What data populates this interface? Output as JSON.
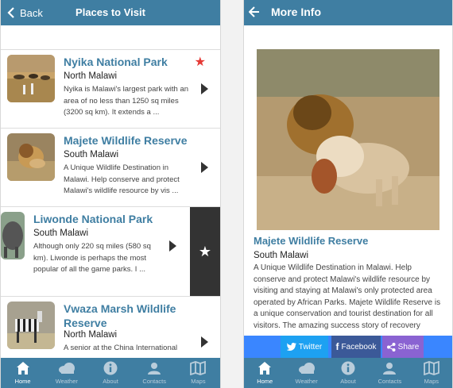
{
  "left_screen": {
    "back_label": "Back",
    "title": "Places to Visit",
    "places": [
      {
        "name": "Nyika National Park",
        "region": "North Malawi",
        "description": "Nyika is Malawi's largest park with an area of no less than 1250 sq miles (3200 sq km). It extends a ...",
        "favorite": true
      },
      {
        "name": "Majete Wildlife Reserve",
        "region": "South Malawi",
        "description": "A Unique Wildlife Destination in Malawi. Help conserve and protect Malawi's wildlife resource by vis ...",
        "favorite": false
      },
      {
        "name": "Liwonde National Park",
        "region": "South Malawi",
        "description": "Although only 220 sq miles (580 sq km). Liwonde is perhaps the most popular of all the game parks. I ...",
        "favorite": false
      },
      {
        "name": "Vwaza Marsh Wildlife Reserve",
        "region": "North Malawi",
        "description": "A senior at the China International",
        "favorite": false
      }
    ]
  },
  "right_screen": {
    "title": "More Info",
    "name": "Majete Wildlife Reserve",
    "region": "South Malawi",
    "description": "A Unique Wildlife Destination in Malawi. Help conserve and protect Malawi's wildlife resource by visiting and staying at Malawi's only protected area operated by African Parks. Majete Wildlife Reserve is a unique conservation and tourist destination for all visitors. The amazing success story of recovery",
    "share": {
      "twitter": "Twitter",
      "facebook": "Facebook",
      "share": "Share"
    }
  },
  "tabs": [
    "Home",
    "Weather",
    "About",
    "Contacts",
    "Maps"
  ],
  "colors": {
    "header": "#3f7ea2",
    "accent_star": "#e53935",
    "twitter": "#1da1f2",
    "facebook": "#3b5998",
    "share": "#8a63d2"
  }
}
